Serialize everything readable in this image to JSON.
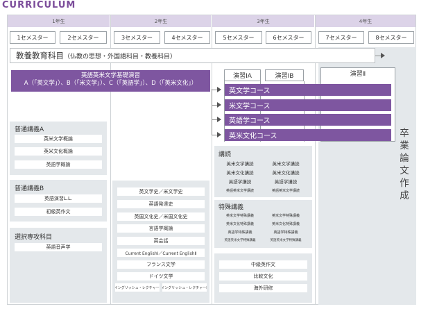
{
  "title": "CURRICULUM",
  "years": [
    "1年生",
    "2年生",
    "3年生",
    "4年生"
  ],
  "semesters": [
    "1セメスター",
    "2セメスター",
    "3セメスター",
    "4セメスター",
    "5セメスター",
    "6セメスター",
    "7セメスター",
    "8セメスター"
  ],
  "general": {
    "main": "教養教育科目",
    "sub": "（仏教の思想・外国語科目・教養科目）"
  },
  "basic_seminar": {
    "line1": "英語英米文学基礎演習",
    "line2": "A（「英文学」）、B（「米文学」）、C（「英語学」）、D（「英米文化」）"
  },
  "seminars": [
    "演習ⅠA",
    "演習ⅠB",
    "演習Ⅱ"
  ],
  "courses": [
    "英文学コース",
    "米文学コース",
    "英語学コース",
    "英米文化コース"
  ],
  "thesis": [
    "卒",
    "業",
    "論",
    "文",
    "作",
    "成"
  ],
  "lecture_a": {
    "label": "普通講義A",
    "items": [
      "英米文学概論",
      "英米文化概論",
      "英語学概論"
    ]
  },
  "lecture_b": {
    "label": "普通講義B",
    "items": [
      "英語演習L.L.",
      "初級英作文"
    ]
  },
  "elective": {
    "label": "選択専攻科目",
    "items": [
      "英語音声学"
    ]
  },
  "y2_list": [
    "英文学史／米文学史",
    "英語発達史",
    "英国文化史／米国文化史",
    "言語学概論",
    "英会話",
    "Current EnglishⅠ／Current EnglishⅡ",
    "フランス文学",
    "ドイツ文学"
  ],
  "y2_pair": [
    "イングリッシュ・レクチャーⅠ",
    "イングリッシュ・レクチャーⅡ"
  ],
  "reading": {
    "label": "講読",
    "col1": [
      "英米文学講読",
      "英米文化講読",
      "英語学講読",
      "英語英米文学講読"
    ],
    "col2": [
      "英米文学講読",
      "英米文化講読",
      "英語学講読",
      "英語英米文学講読"
    ]
  },
  "special": {
    "label": "特殊講義",
    "col1": [
      "英米文学特殊講義",
      "英米文化特殊講義",
      "英語学特殊講義",
      "英語英米文学特殊講義"
    ],
    "col2": [
      "英米文学特殊講義",
      "英米文化特殊講義",
      "英語学特殊講義",
      "英語英米文学特殊講義"
    ]
  },
  "y3_bottom": [
    "中級英作文",
    "比較文化",
    "海外研修"
  ],
  "colors": {
    "purple": "#7e56a0",
    "year_header": "#dcd3e8",
    "panel_gray": "#e4e8eb",
    "title": "#7b4c9a"
  }
}
